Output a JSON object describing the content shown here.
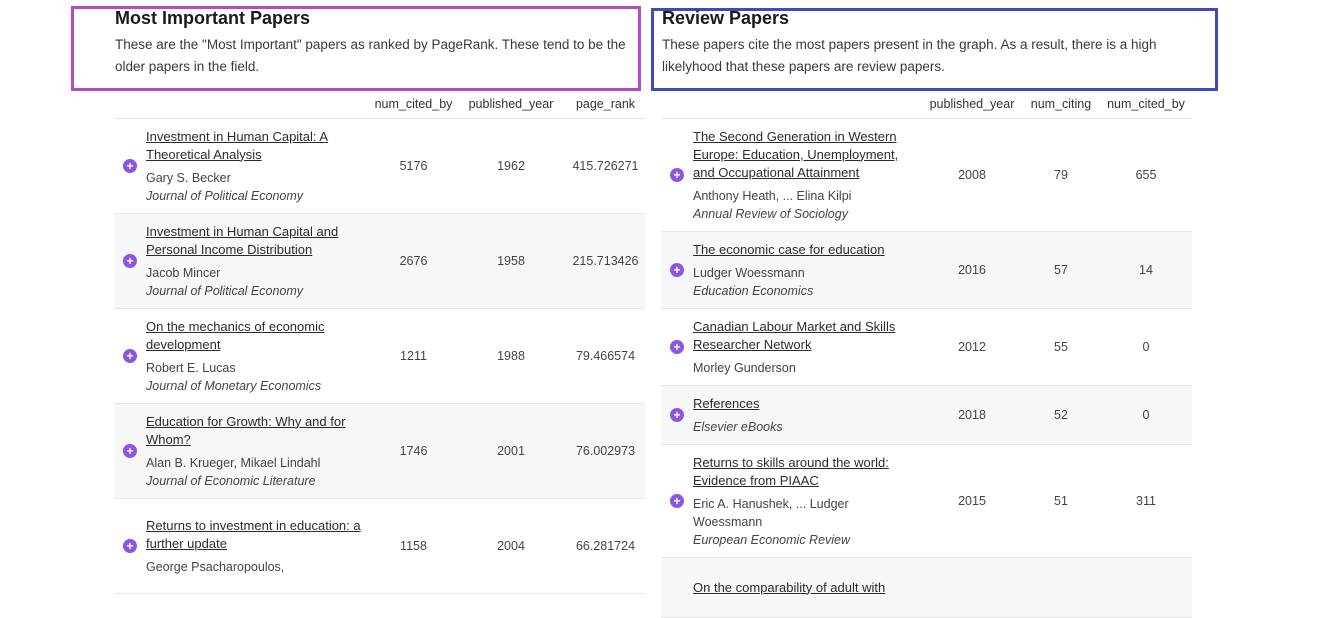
{
  "left": {
    "title": "Most Important Papers",
    "description": "These are the \"Most Important\" papers as ranked by PageRank. These tend to be the older papers in the field.",
    "columns": [
      "num_cited_by",
      "published_year",
      "page_rank"
    ],
    "rows": [
      {
        "title": "Investment in Human Capital: A Theoretical Analysis",
        "authors": "Gary S. Becker",
        "journal": "Journal of Political Economy",
        "values": [
          "5176",
          "1962",
          "415.726271"
        ]
      },
      {
        "title": "Investment in Human Capital and Personal Income Distribution",
        "authors": "Jacob Mincer",
        "journal": "Journal of Political Economy",
        "values": [
          "2676",
          "1958",
          "215.713426"
        ]
      },
      {
        "title": "On the mechanics of economic development",
        "authors": "Robert E. Lucas",
        "journal": "Journal of Monetary Economics",
        "values": [
          "1211",
          "1988",
          "79.466574"
        ]
      },
      {
        "title": "Education for Growth: Why and for Whom?",
        "authors": "Alan B. Krueger, Mikael Lindahl",
        "journal": "Journal of Economic Literature",
        "values": [
          "1746",
          "2001",
          "76.002973"
        ]
      },
      {
        "title": "Returns to investment in education: a further update",
        "authors": "George Psacharopoulos,",
        "journal": "",
        "values": [
          "1158",
          "2004",
          "66.281724"
        ]
      }
    ]
  },
  "right": {
    "title": "Review Papers",
    "description": "These papers cite the most papers present in the graph. As a result, there is a high likelyhood that these papers are review papers.",
    "columns": [
      "published_year",
      "num_citing",
      "num_cited_by"
    ],
    "rows": [
      {
        "title": "The Second Generation in Western Europe: Education, Unemployment, and Occupational Attainment",
        "authors": "Anthony Heath, ... Elina Kilpi",
        "journal": "Annual Review of Sociology",
        "values": [
          "2008",
          "79",
          "655"
        ]
      },
      {
        "title": "The economic case for education",
        "authors": "Ludger Woessmann",
        "journal": "Education Economics",
        "values": [
          "2016",
          "57",
          "14"
        ]
      },
      {
        "title": "Canadian Labour Market and Skills Researcher Network",
        "authors": "Morley Gunderson",
        "journal": "",
        "values": [
          "2012",
          "55",
          "0"
        ]
      },
      {
        "title": "References",
        "authors": "",
        "journal": "Elsevier eBooks",
        "values": [
          "2018",
          "52",
          "0"
        ]
      },
      {
        "title": "Returns to skills around the world: Evidence from PIAAC",
        "authors": "Eric A. Hanushek, ... Ludger Woessmann",
        "journal": "European Economic Review",
        "values": [
          "2015",
          "51",
          "311"
        ]
      },
      {
        "title": "On the comparability of adult with",
        "authors": "",
        "journal": "",
        "values": [
          "",
          "",
          ""
        ]
      }
    ]
  },
  "icons": {
    "expand": "+"
  },
  "colors": {
    "left_highlight": "#b54bc3",
    "right_highlight": "#3f49c2",
    "expand_icon": "#8a57e4"
  }
}
